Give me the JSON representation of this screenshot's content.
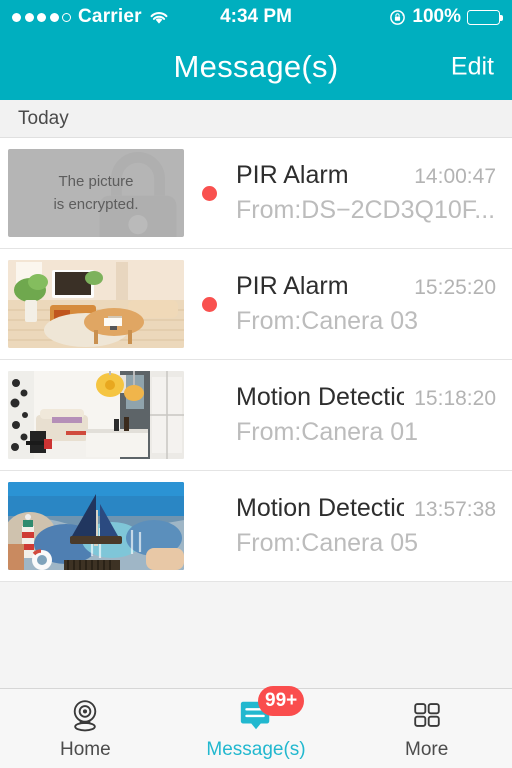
{
  "statusbar": {
    "carrier": "Carrier",
    "signal_dots_filled": 4,
    "signal_dots_total": 5,
    "wifi_icon": "wifi-icon",
    "time": "4:34 PM",
    "rotation_lock_icon": "rotation-lock-icon",
    "battery_percent": "100%",
    "battery_icon": "battery-full-icon",
    "background_color": "#00afbf"
  },
  "navbar": {
    "title": "Message(s)",
    "edit_label": "Edit",
    "background_color": "#00afbf"
  },
  "section": {
    "header": "Today"
  },
  "messages": [
    {
      "title": "PIR Alarm",
      "source": "From:DS−2CD3Q10F...",
      "time": "14:00:47",
      "unread": true,
      "thumbnail_type": "encrypted-placeholder",
      "thumbnail_text_line1": "The picture",
      "thumbnail_text_line2": "is encrypted."
    },
    {
      "title": "PIR Alarm",
      "source": "From:Canera 03",
      "time": "15:25:20",
      "unread": true,
      "thumbnail_type": "living-room-tv",
      "thumbnail_text_line1": "",
      "thumbnail_text_line2": ""
    },
    {
      "title": "Motion Detection",
      "source": "From:Canera 01",
      "time": "15:18:20",
      "unread": false,
      "thumbnail_type": "living-room-lamps",
      "thumbnail_text_line1": "",
      "thumbnail_text_line2": ""
    },
    {
      "title": "Motion Detection",
      "source": "From:Canera 05",
      "time": "13:57:38",
      "unread": false,
      "thumbnail_type": "nautical-pillows",
      "thumbnail_text_line1": "",
      "thumbnail_text_line2": ""
    }
  ],
  "tabbar": {
    "tabs": [
      {
        "label": "Home",
        "icon": "security-camera-icon",
        "active": false,
        "badge": ""
      },
      {
        "label": "Message(s)",
        "icon": "chat-bubble-icon",
        "active": true,
        "badge": "99+"
      },
      {
        "label": "More",
        "icon": "grid-squares-icon",
        "active": false,
        "badge": ""
      }
    ],
    "active_color": "#22b8cf",
    "badge_color": "#fa4d4d"
  },
  "colors": {
    "accent": "#00afbf",
    "unread_dot": "#f9514f",
    "badge": "#fa4d4d",
    "page_background": "#f4f4f4"
  }
}
